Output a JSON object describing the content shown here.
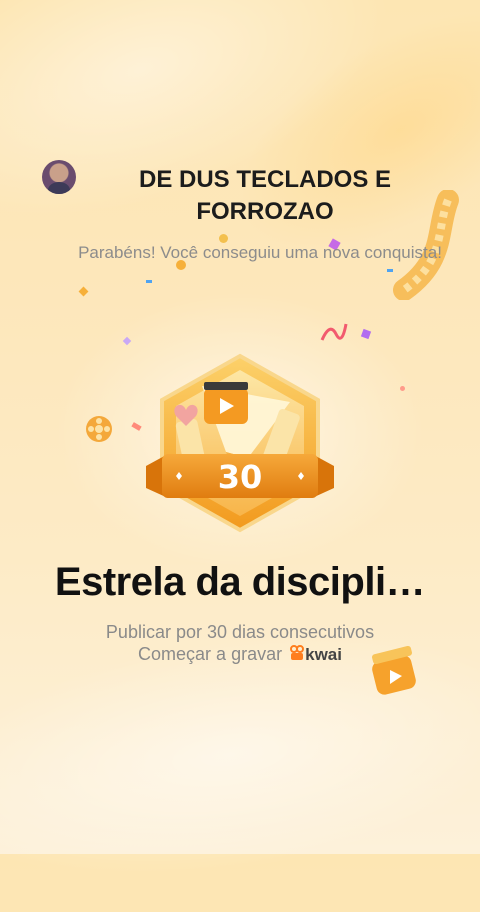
{
  "header": {
    "username": "DE DUS TECLADOS E FORROZAO",
    "congrats": "Parabéns! Você conseguiu uma nova conquista!"
  },
  "badge": {
    "number": "30",
    "accent": "#f5a623",
    "icon": "film-clapper-badge-icon"
  },
  "achievement": {
    "title": "Estrela da discipli…",
    "description": "Publicar por 30 dias consecutivos",
    "cta_label": "Começar a gravar",
    "brand": "kwai",
    "brand_color": "#ff7e1e"
  }
}
